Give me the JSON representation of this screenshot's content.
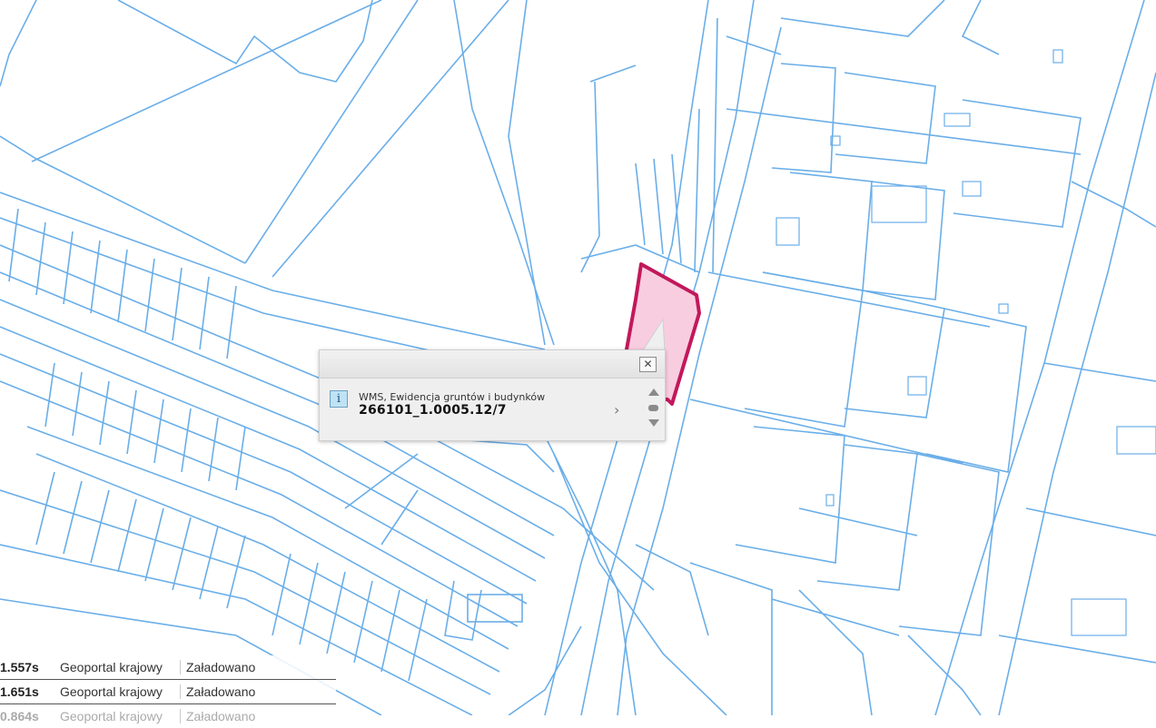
{
  "map": {
    "parcel_color": "#6aaee8",
    "highlight_fill": "#f9cde0",
    "highlight_stroke": "#c2185b"
  },
  "popup": {
    "close_glyph": "✕",
    "info_glyph": "i",
    "layer_title": "WMS, Ewidencja gruntów i budynków",
    "parcel_id": "266101_1.0005.12/7",
    "next_glyph": "›"
  },
  "log": [
    {
      "time": "1.557s",
      "source": "Geoportal krajowy",
      "status": "Załadowano"
    },
    {
      "time": "1.651s",
      "source": "Geoportal krajowy",
      "status": "Załadowano"
    },
    {
      "time": "0.864s",
      "source": "Geoportal krajowy",
      "status": "Załadowano"
    }
  ]
}
